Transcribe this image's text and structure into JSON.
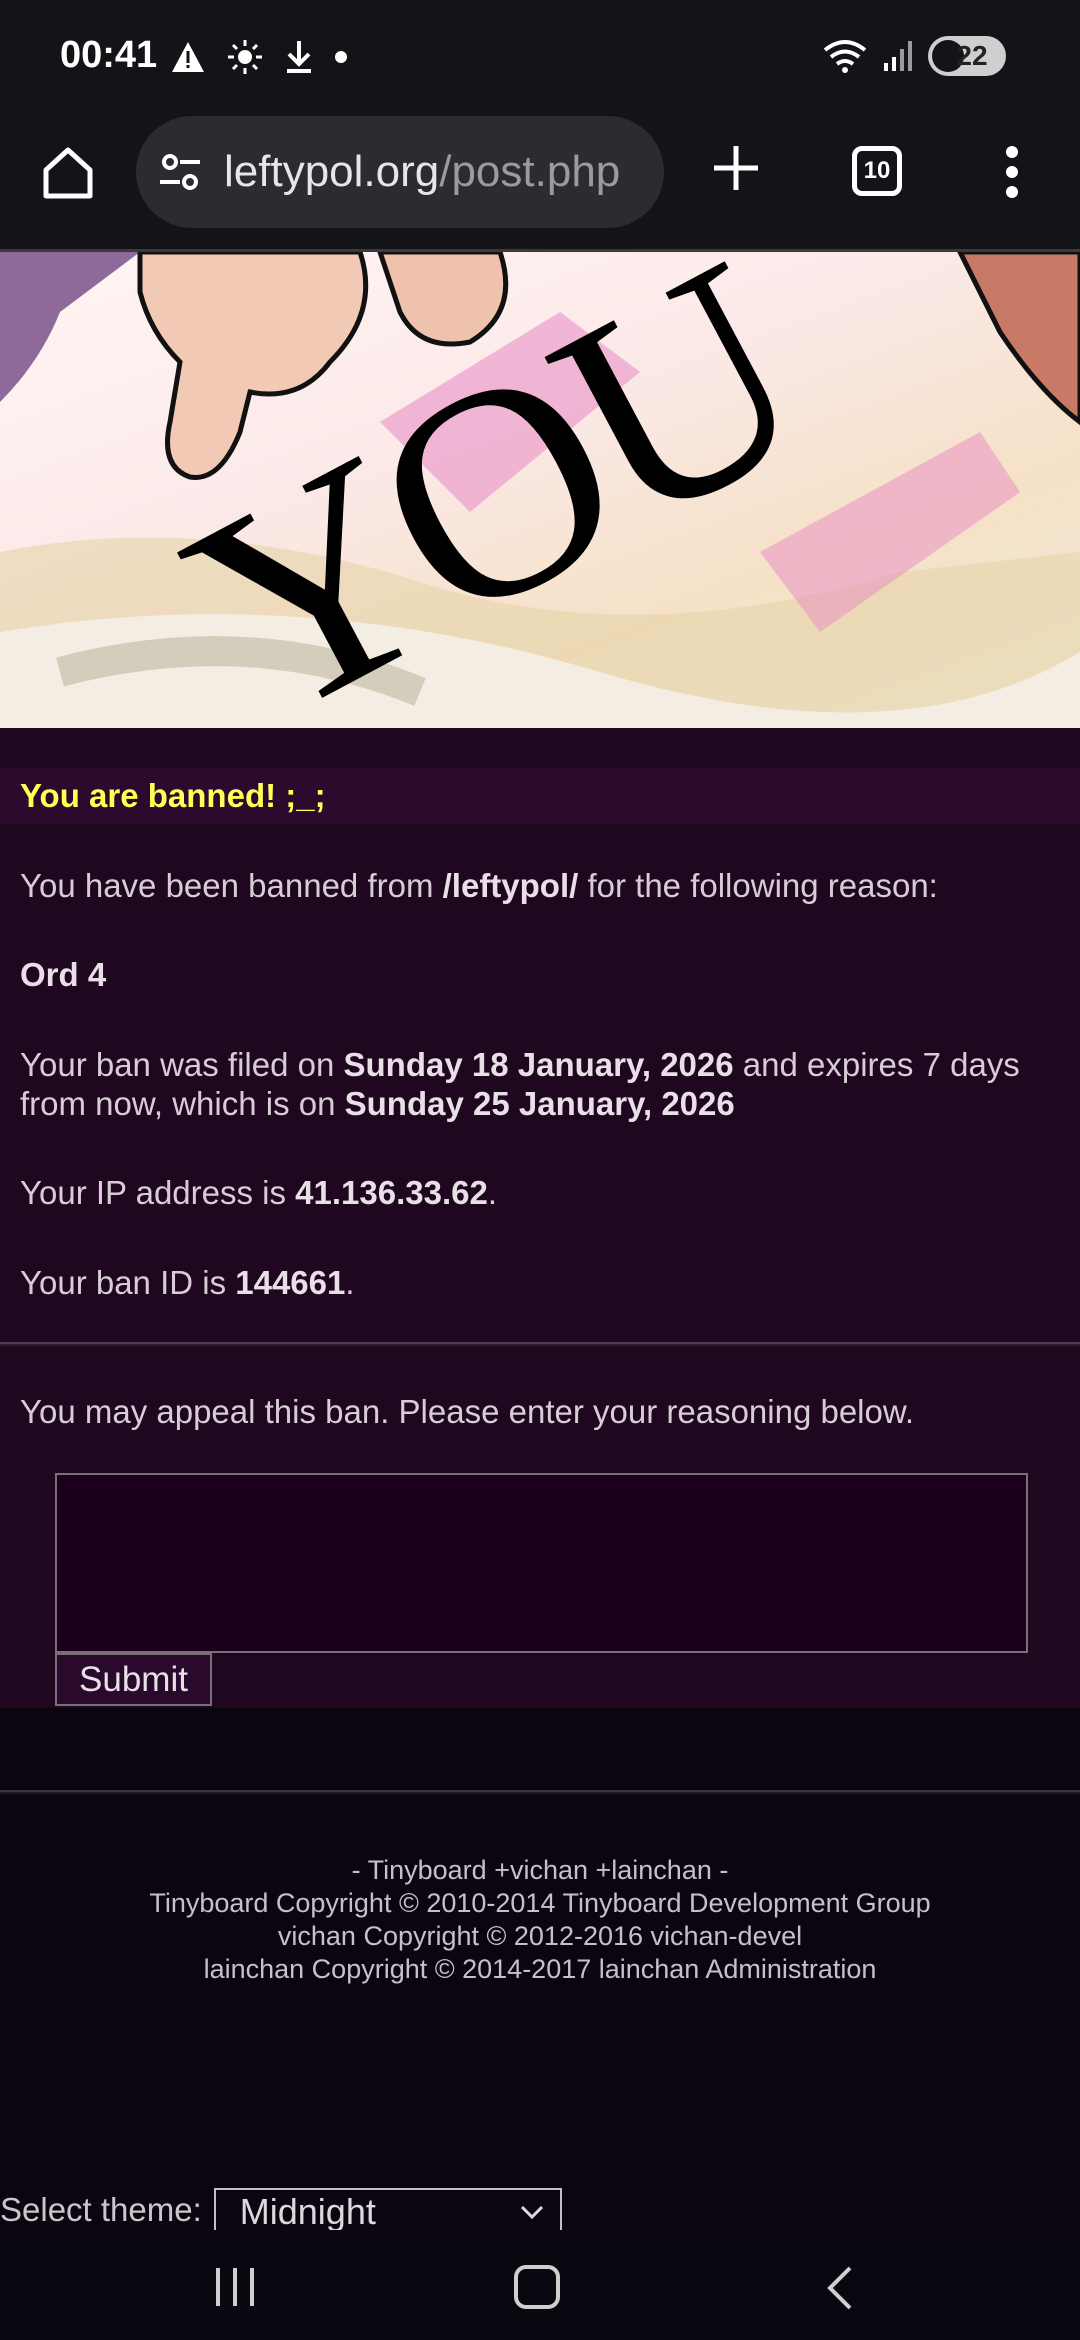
{
  "status_bar": {
    "time": "00:41",
    "battery": "22",
    "icons": [
      "warning-icon",
      "brightness-icon",
      "download-icon",
      "dot-icon",
      "wifi-icon",
      "signal-icon",
      "battery-icon"
    ]
  },
  "browser": {
    "url_main": "leftypol.org",
    "url_rest": "/post.php",
    "tab_count": "10"
  },
  "banner": {
    "text": "YOU"
  },
  "ban": {
    "heading": "You are banned! ;_;",
    "reason_intro_1": "You have been banned from ",
    "board": "/leftypol/",
    "reason_intro_2": " for the following reason:",
    "reason": "Ord 4",
    "filed_1": "Your ban was filed on ",
    "filed_date": "Sunday 18 January, 2026",
    "filed_2": " and expires 7 days from now, which is on ",
    "expires_date": "Sunday 25 January, 2026",
    "ip_1": "Your IP address is ",
    "ip": "41.136.33.62",
    "ip_2": ".",
    "id_1": "Your ban ID is ",
    "ban_id": "144661",
    "id_2": "."
  },
  "appeal": {
    "prompt": "You may appeal this ban. Please enter your reasoning below.",
    "textarea_value": "",
    "submit_label": "Submit"
  },
  "footer": {
    "line1": "- Tinyboard +vichan +lainchan -",
    "line2": "Tinyboard Copyright © 2010-2014 Tinyboard Development Group",
    "line3": "vichan Copyright © 2012-2016 vichan-devel",
    "line4": "lainchan Copyright © 2014-2017 lainchan Administration"
  },
  "theme": {
    "label": "Select theme:",
    "selected": "Midnight"
  },
  "colors": {
    "heading_yellow": "#ffff55",
    "content_bg": "#1f0720",
    "page_bg": "#0b0510"
  }
}
